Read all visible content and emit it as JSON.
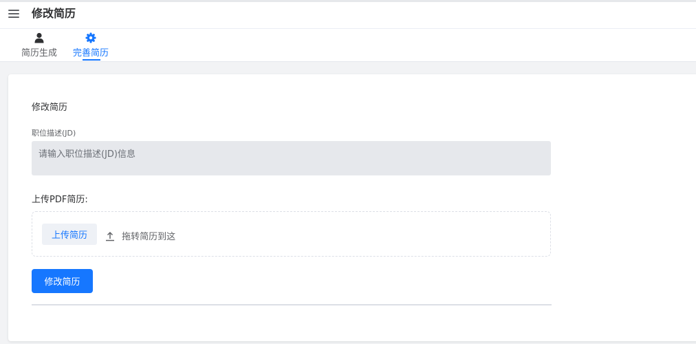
{
  "header": {
    "title": "修改简历",
    "menu_icon": "hamburger-menu-icon"
  },
  "tabs": [
    {
      "label": "简历生成",
      "icon": "user-icon",
      "active": false
    },
    {
      "label": "完善简历",
      "icon": "gear-icon",
      "active": true
    }
  ],
  "form": {
    "section_title": "修改简历",
    "jd_label": "职位描述(JD)",
    "jd_placeholder": "请输入职位描述(JD)信息",
    "jd_value": "",
    "upload_label": "上传PDF简历:",
    "upload_button": "上传简历",
    "drag_text": "拖转简历到这",
    "upload_icon": "upload-icon",
    "submit_button": "修改简历"
  },
  "colors": {
    "accent": "#1677ff",
    "input_bg": "#e6e8ec",
    "page_bg": "#f2f3f5"
  }
}
